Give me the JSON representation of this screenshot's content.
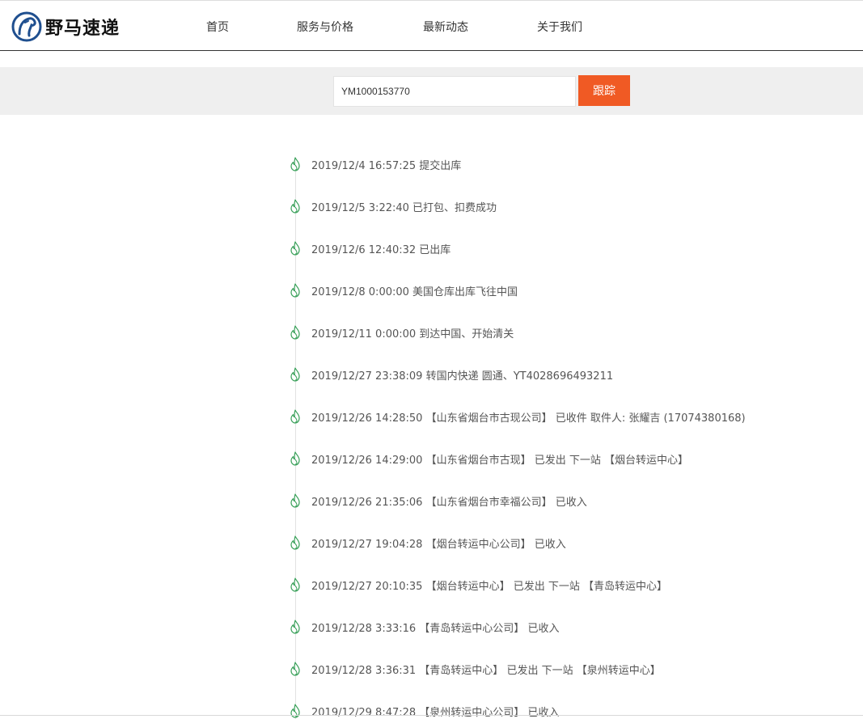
{
  "brand": {
    "name": "野马速递",
    "accent": "#f05a24",
    "mark_color": "#1f4f8f"
  },
  "nav": {
    "items": [
      "首页",
      "服务与价格",
      "最新动态",
      "关于我们"
    ]
  },
  "search": {
    "value": "YM1000153770",
    "button_label": "跟踪"
  },
  "timeline": {
    "icon": "flame-icon",
    "icon_color": "#3aa05a",
    "events": [
      "2019/12/4 16:57:25 提交出库",
      "2019/12/5 3:22:40 已打包、扣费成功",
      "2019/12/6 12:40:32 已出库",
      "2019/12/8 0:00:00 美国仓库出库飞往中国",
      "2019/12/11 0:00:00 到达中国、开始清关",
      "2019/12/27 23:38:09 转国内快递 圆通、YT4028696493211",
      "2019/12/26 14:28:50 【山东省烟台市古现公司】 已收件 取件人: 张耀吉 (17074380168)",
      "2019/12/26 14:29:00 【山东省烟台市古现】 已发出 下一站 【烟台转运中心】",
      "2019/12/26 21:35:06 【山东省烟台市幸福公司】 已收入",
      "2019/12/27 19:04:28 【烟台转运中心公司】 已收入",
      "2019/12/27 20:10:35 【烟台转运中心】 已发出 下一站 【青岛转运中心】",
      "2019/12/28 3:33:16 【青岛转运中心公司】 已收入",
      "2019/12/28 3:36:31 【青岛转运中心】 已发出 下一站 【泉州转运中心】",
      "2019/12/29 8:47:28 【泉州转运中心公司】 已收入"
    ]
  }
}
